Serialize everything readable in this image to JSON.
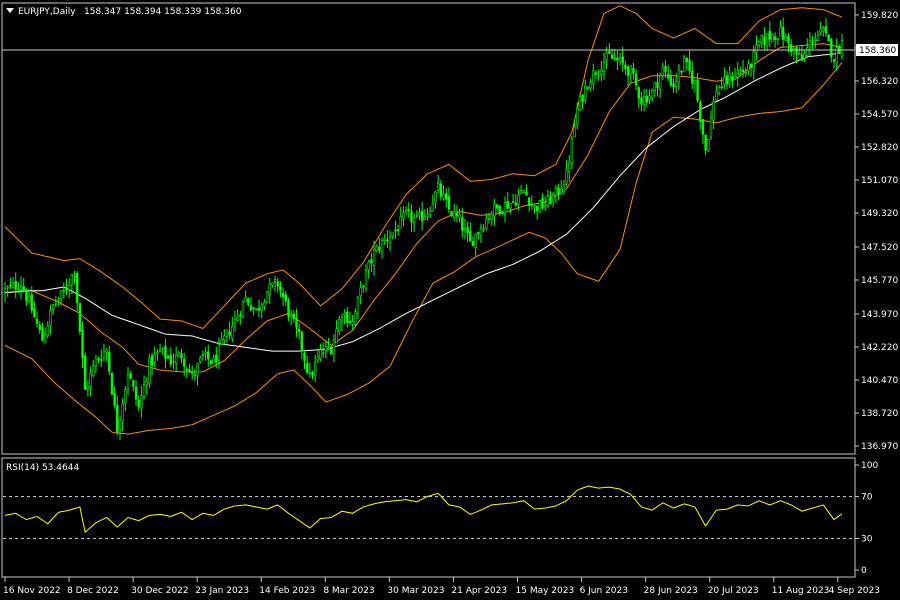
{
  "header": {
    "symbol_timeframe": "EURJPY,Daily",
    "ohlc": "158.347 158.394 158.339 158.360"
  },
  "rsi_header": "RSI(14) 53.4644",
  "current_price_label": "158.360",
  "colors": {
    "background": "#000000",
    "axis": "#c8c8c8",
    "candle": "#00ff00",
    "bollinger": "#ff8c00",
    "ma_white": "#ffffff",
    "rsi_line": "#ffff00",
    "level_line": "#c8c8c8"
  },
  "chart_data": [
    {
      "type": "candlestick",
      "title": "EURJPY,Daily",
      "y_ticks": [
        159.82,
        158.07,
        156.32,
        154.57,
        152.82,
        151.07,
        149.32,
        147.52,
        145.77,
        143.97,
        142.22,
        140.47,
        138.72,
        136.97
      ],
      "y_tick_labels": [
        "159.820",
        "158.070",
        "156.320",
        "154.570",
        "152.820",
        "151.070",
        "149.320",
        "147.520",
        "145.770",
        "143.970",
        "142.220",
        "140.470",
        "138.720",
        "136.970"
      ],
      "ylim": [
        136.6,
        160.4
      ],
      "x_tick_labels": [
        "16 Nov 2022",
        "8 Dec 2022",
        "30 Dec 2022",
        "23 Jan 2023",
        "14 Feb 2023",
        "8 Mar 2023",
        "30 Mar 2023",
        "21 Apr 2023",
        "15 May 2023",
        "6 Jun 2023",
        "28 Jun 2023",
        "20 Jul 2023",
        "11 Aug 2023",
        "4 Sep 2023"
      ],
      "close_anchors": [
        [
          0,
          145.2
        ],
        [
          6,
          145.6
        ],
        [
          10,
          144.2
        ],
        [
          14,
          142.6
        ],
        [
          18,
          144.4
        ],
        [
          22,
          145.1
        ],
        [
          26,
          146.3
        ],
        [
          30,
          139.9
        ],
        [
          34,
          141.5
        ],
        [
          38,
          142.1
        ],
        [
          42,
          137.9
        ],
        [
          46,
          140.9
        ],
        [
          50,
          139.0
        ],
        [
          54,
          141.3
        ],
        [
          58,
          142.0
        ],
        [
          62,
          141.5
        ],
        [
          66,
          141.8
        ],
        [
          70,
          140.6
        ],
        [
          74,
          141.7
        ],
        [
          78,
          141.4
        ],
        [
          82,
          142.6
        ],
        [
          86,
          143.6
        ],
        [
          90,
          144.8
        ],
        [
          94,
          144.1
        ],
        [
          98,
          145.2
        ],
        [
          102,
          145.6
        ],
        [
          106,
          144.1
        ],
        [
          110,
          142.7
        ],
        [
          114,
          140.6
        ],
        [
          118,
          141.9
        ],
        [
          122,
          142.2
        ],
        [
          126,
          144.1
        ],
        [
          130,
          143.5
        ],
        [
          134,
          145.7
        ],
        [
          138,
          147.2
        ],
        [
          142,
          147.9
        ],
        [
          146,
          148.4
        ],
        [
          150,
          149.2
        ],
        [
          154,
          148.9
        ],
        [
          158,
          149.4
        ],
        [
          162,
          150.6
        ],
        [
          166,
          149.5
        ],
        [
          170,
          148.9
        ],
        [
          174,
          147.7
        ],
        [
          178,
          148.6
        ],
        [
          182,
          149.4
        ],
        [
          186,
          149.7
        ],
        [
          190,
          149.9
        ],
        [
          194,
          150.5
        ],
        [
          198,
          149.6
        ],
        [
          202,
          149.8
        ],
        [
          206,
          150.3
        ],
        [
          210,
          151.3
        ],
        [
          214,
          154.8
        ],
        [
          218,
          156.3
        ],
        [
          222,
          157.1
        ],
        [
          226,
          157.6
        ],
        [
          230,
          157.3
        ],
        [
          234,
          156.8
        ],
        [
          238,
          155.3
        ],
        [
          242,
          155.7
        ],
        [
          246,
          156.9
        ],
        [
          250,
          156.1
        ],
        [
          254,
          157.3
        ],
        [
          258,
          156.2
        ],
        [
          262,
          152.7
        ],
        [
          266,
          155.9
        ],
        [
          270,
          156.3
        ],
        [
          274,
          156.8
        ],
        [
          278,
          156.9
        ],
        [
          282,
          158.3
        ],
        [
          286,
          158.7
        ],
        [
          290,
          158.9
        ],
        [
          294,
          158.1
        ],
        [
          298,
          157.4
        ],
        [
          302,
          158.6
        ],
        [
          306,
          158.9
        ],
        [
          310,
          157.6
        ],
        [
          313,
          158.36
        ]
      ],
      "bollinger_upper_anchors": [
        [
          0,
          148.6
        ],
        [
          10,
          147.2
        ],
        [
          22,
          146.8
        ],
        [
          28,
          146.9
        ],
        [
          36,
          146.2
        ],
        [
          44,
          145.4
        ],
        [
          50,
          144.7
        ],
        [
          58,
          143.7
        ],
        [
          66,
          143.6
        ],
        [
          74,
          143.2
        ],
        [
          82,
          144.4
        ],
        [
          90,
          145.6
        ],
        [
          98,
          146.1
        ],
        [
          104,
          146.3
        ],
        [
          110,
          145.6
        ],
        [
          118,
          144.4
        ],
        [
          126,
          145.3
        ],
        [
          134,
          146.7
        ],
        [
          142,
          148.6
        ],
        [
          150,
          150.3
        ],
        [
          158,
          151.4
        ],
        [
          166,
          151.9
        ],
        [
          174,
          151.0
        ],
        [
          182,
          151.1
        ],
        [
          190,
          151.4
        ],
        [
          198,
          151.3
        ],
        [
          206,
          151.9
        ],
        [
          212,
          153.6
        ],
        [
          218,
          157.4
        ],
        [
          224,
          159.9
        ],
        [
          230,
          160.3
        ],
        [
          236,
          159.9
        ],
        [
          242,
          159.1
        ],
        [
          250,
          158.6
        ],
        [
          258,
          159.1
        ],
        [
          266,
          158.3
        ],
        [
          274,
          158.3
        ],
        [
          282,
          159.5
        ],
        [
          290,
          160.1
        ],
        [
          298,
          160.2
        ],
        [
          306,
          160.1
        ],
        [
          313,
          159.7
        ]
      ],
      "bollinger_middle_anchors": [
        [
          0,
          145.1
        ],
        [
          10,
          145.2
        ],
        [
          20,
          144.6
        ],
        [
          28,
          144.0
        ],
        [
          36,
          143.0
        ],
        [
          44,
          142.2
        ],
        [
          50,
          141.3
        ],
        [
          58,
          141.0
        ],
        [
          66,
          140.9
        ],
        [
          74,
          140.9
        ],
        [
          82,
          141.5
        ],
        [
          90,
          142.6
        ],
        [
          98,
          143.6
        ],
        [
          106,
          144.0
        ],
        [
          114,
          143.2
        ],
        [
          122,
          142.3
        ],
        [
          130,
          143.1
        ],
        [
          138,
          144.7
        ],
        [
          146,
          146.1
        ],
        [
          154,
          147.7
        ],
        [
          162,
          148.9
        ],
        [
          170,
          149.4
        ],
        [
          178,
          149.2
        ],
        [
          186,
          149.3
        ],
        [
          194,
          149.7
        ],
        [
          202,
          149.9
        ],
        [
          210,
          150.6
        ],
        [
          218,
          152.4
        ],
        [
          226,
          154.7
        ],
        [
          234,
          156.2
        ],
        [
          242,
          156.6
        ],
        [
          250,
          156.6
        ],
        [
          258,
          156.5
        ],
        [
          266,
          156.3
        ],
        [
          274,
          156.5
        ],
        [
          282,
          157.4
        ],
        [
          290,
          158.1
        ],
        [
          298,
          158.2
        ],
        [
          306,
          158.3
        ],
        [
          313,
          158.1
        ]
      ],
      "bollinger_lower_anchors": [
        [
          0,
          142.3
        ],
        [
          10,
          141.6
        ],
        [
          18,
          140.4
        ],
        [
          26,
          139.4
        ],
        [
          34,
          138.5
        ],
        [
          40,
          137.7
        ],
        [
          46,
          137.6
        ],
        [
          54,
          137.8
        ],
        [
          62,
          137.9
        ],
        [
          70,
          138.1
        ],
        [
          78,
          138.6
        ],
        [
          86,
          139.1
        ],
        [
          94,
          139.8
        ],
        [
          102,
          140.8
        ],
        [
          108,
          141.0
        ],
        [
          114,
          140.2
        ],
        [
          120,
          139.3
        ],
        [
          128,
          139.7
        ],
        [
          136,
          140.3
        ],
        [
          144,
          141.2
        ],
        [
          152,
          143.5
        ],
        [
          160,
          145.6
        ],
        [
          168,
          146.2
        ],
        [
          176,
          147.0
        ],
        [
          184,
          147.5
        ],
        [
          190,
          147.9
        ],
        [
          196,
          148.3
        ],
        [
          202,
          148.0
        ],
        [
          208,
          147.2
        ],
        [
          214,
          146.1
        ],
        [
          222,
          145.7
        ],
        [
          230,
          147.4
        ],
        [
          236,
          150.9
        ],
        [
          242,
          153.6
        ],
        [
          250,
          154.4
        ],
        [
          258,
          154.3
        ],
        [
          266,
          154.1
        ],
        [
          274,
          154.4
        ],
        [
          282,
          154.6
        ],
        [
          290,
          154.7
        ],
        [
          298,
          154.9
        ],
        [
          306,
          156.1
        ],
        [
          313,
          157.3
        ]
      ],
      "ma_white_anchors": [
        [
          0,
          145.1
        ],
        [
          8,
          145.2
        ],
        [
          14,
          145.2
        ],
        [
          22,
          145.4
        ],
        [
          30,
          144.8
        ],
        [
          40,
          143.9
        ],
        [
          50,
          143.4
        ],
        [
          60,
          142.9
        ],
        [
          70,
          142.8
        ],
        [
          80,
          142.4
        ],
        [
          90,
          142.2
        ],
        [
          100,
          142.0
        ],
        [
          110,
          142.0
        ],
        [
          120,
          142.1
        ],
        [
          130,
          142.5
        ],
        [
          140,
          143.2
        ],
        [
          150,
          144.0
        ],
        [
          160,
          144.7
        ],
        [
          170,
          145.4
        ],
        [
          180,
          146.1
        ],
        [
          190,
          146.6
        ],
        [
          200,
          147.3
        ],
        [
          210,
          148.2
        ],
        [
          220,
          149.6
        ],
        [
          230,
          151.3
        ],
        [
          240,
          152.8
        ],
        [
          250,
          153.9
        ],
        [
          260,
          154.8
        ],
        [
          270,
          155.5
        ],
        [
          280,
          156.3
        ],
        [
          290,
          157.0
        ],
        [
          300,
          157.6
        ],
        [
          306,
          157.7
        ],
        [
          313,
          157.8
        ]
      ]
    },
    {
      "type": "line",
      "title": "RSI(14) 53.4644",
      "ylim": [
        0,
        100
      ],
      "y_ticks": [
        100,
        70,
        30,
        0
      ],
      "levels": [
        70,
        30
      ],
      "rsi_anchors": [
        [
          0,
          52
        ],
        [
          4,
          54
        ],
        [
          8,
          48
        ],
        [
          12,
          51
        ],
        [
          16,
          44
        ],
        [
          20,
          55
        ],
        [
          24,
          57
        ],
        [
          28,
          60
        ],
        [
          30,
          36
        ],
        [
          34,
          45
        ],
        [
          38,
          50
        ],
        [
          42,
          41
        ],
        [
          46,
          50
        ],
        [
          50,
          47
        ],
        [
          54,
          52
        ],
        [
          58,
          53
        ],
        [
          62,
          51
        ],
        [
          66,
          55
        ],
        [
          70,
          48
        ],
        [
          74,
          54
        ],
        [
          78,
          52
        ],
        [
          82,
          58
        ],
        [
          86,
          61
        ],
        [
          90,
          62
        ],
        [
          94,
          60
        ],
        [
          98,
          58
        ],
        [
          102,
          62
        ],
        [
          106,
          54
        ],
        [
          110,
          47
        ],
        [
          114,
          40
        ],
        [
          118,
          49
        ],
        [
          122,
          50
        ],
        [
          126,
          56
        ],
        [
          130,
          54
        ],
        [
          134,
          60
        ],
        [
          138,
          63
        ],
        [
          142,
          65
        ],
        [
          146,
          66
        ],
        [
          150,
          67
        ],
        [
          154,
          65
        ],
        [
          158,
          70
        ],
        [
          162,
          73
        ],
        [
          166,
          62
        ],
        [
          170,
          60
        ],
        [
          174,
          53
        ],
        [
          178,
          57
        ],
        [
          182,
          62
        ],
        [
          186,
          63
        ],
        [
          190,
          64
        ],
        [
          194,
          66
        ],
        [
          198,
          58
        ],
        [
          202,
          59
        ],
        [
          206,
          61
        ],
        [
          210,
          66
        ],
        [
          214,
          76
        ],
        [
          218,
          80
        ],
        [
          222,
          78
        ],
        [
          226,
          79
        ],
        [
          230,
          77
        ],
        [
          234,
          72
        ],
        [
          238,
          60
        ],
        [
          242,
          57
        ],
        [
          246,
          64
        ],
        [
          250,
          59
        ],
        [
          254,
          63
        ],
        [
          258,
          60
        ],
        [
          262,
          42
        ],
        [
          266,
          57
        ],
        [
          270,
          58
        ],
        [
          274,
          62
        ],
        [
          278,
          61
        ],
        [
          282,
          66
        ],
        [
          286,
          62
        ],
        [
          290,
          66
        ],
        [
          294,
          62
        ],
        [
          298,
          56
        ],
        [
          302,
          59
        ],
        [
          306,
          62
        ],
        [
          310,
          48
        ],
        [
          313,
          53.46
        ]
      ]
    }
  ]
}
